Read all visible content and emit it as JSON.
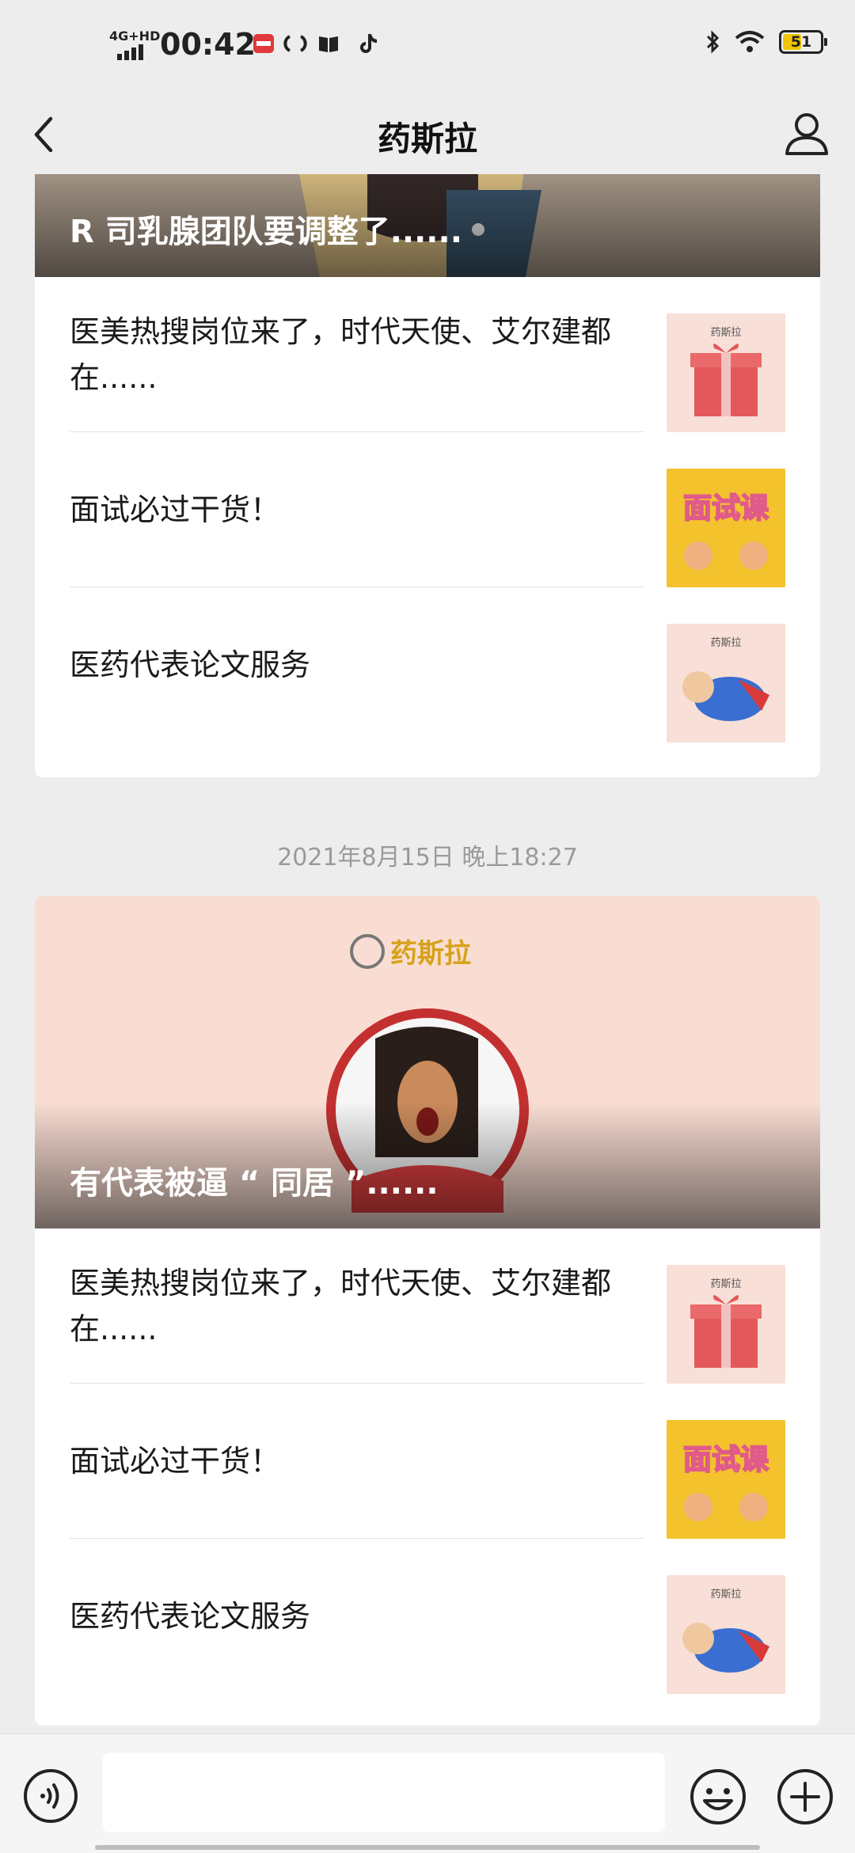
{
  "status_bar": {
    "network": "4G+HD",
    "time": "00:42",
    "battery": "51",
    "battery_level_pct": 51
  },
  "nav": {
    "title": "药斯拉"
  },
  "article_group_1": {
    "cover_title": "R 司乳腺团队要调整了......",
    "items": [
      {
        "title": "医美热搜岗位来了，时代天使、艾尔建都在......",
        "thumb": "gift-box"
      },
      {
        "title": "面试必过干货！",
        "thumb": "interview-course"
      },
      {
        "title": "医药代表论文服务",
        "thumb": "superhero"
      }
    ]
  },
  "timestamp": "2021年8月15日 晚上18:27",
  "article_group_2": {
    "cover_brand": "药斯拉",
    "cover_title": "有代表被逼 “ 同居 ”......",
    "items": [
      {
        "title": "医美热搜岗位来了，时代天使、艾尔建都在......",
        "thumb": "gift-box"
      },
      {
        "title": "面试必过干货！",
        "thumb": "interview-course"
      },
      {
        "title": "医药代表论文服务",
        "thumb": "superhero"
      }
    ]
  },
  "thumb_text": {
    "brand": "药斯拉",
    "course": "面试课"
  },
  "colors": {
    "accent_yellow": "#f3c22d",
    "thumb_pink": "#f8dfd7",
    "background": "#ededed"
  }
}
